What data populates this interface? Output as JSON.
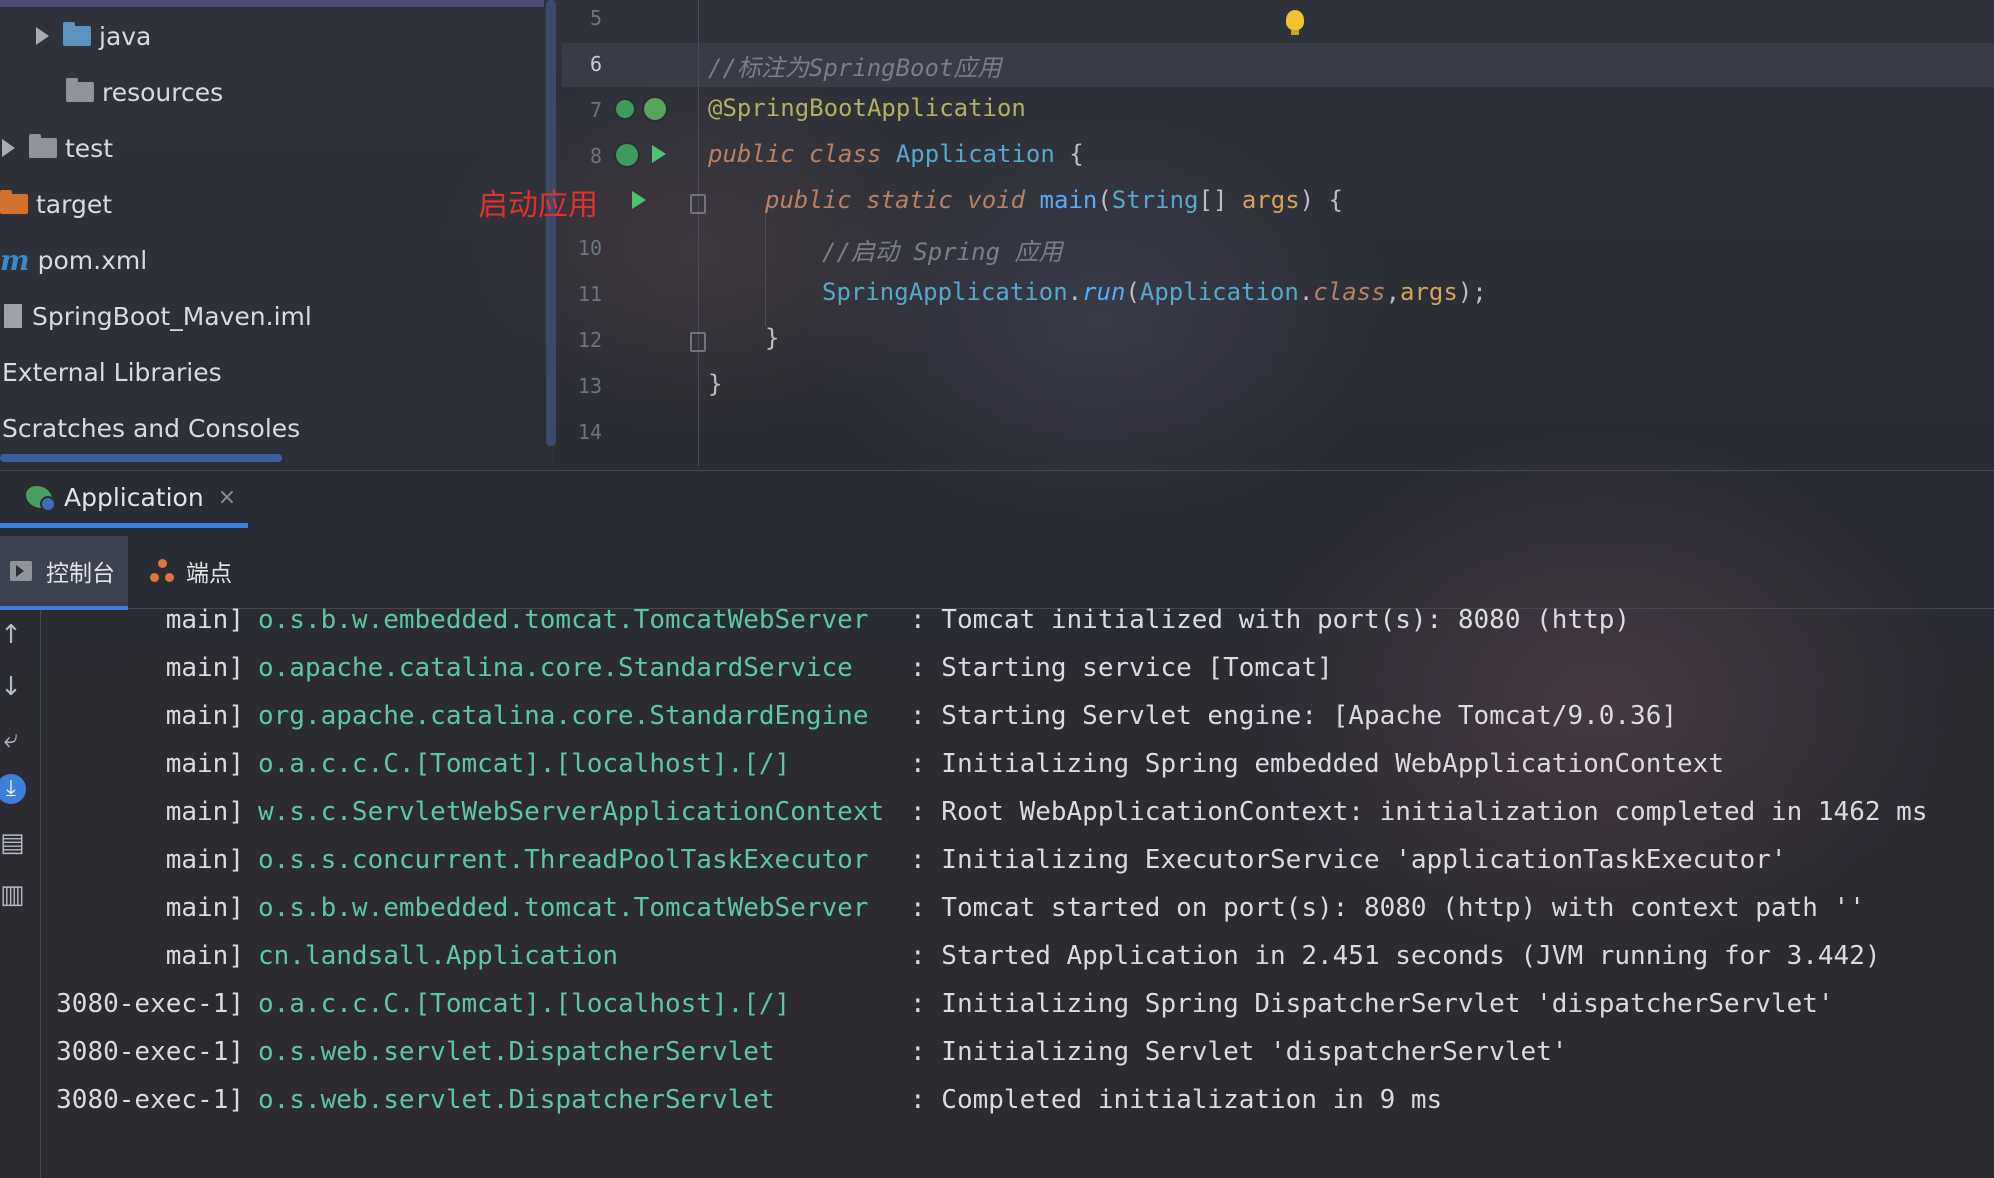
{
  "project_tree": {
    "items": [
      {
        "label": "java",
        "icon": "source-folder-icon"
      },
      {
        "label": "resources",
        "icon": "resources-folder-icon"
      },
      {
        "label": "test",
        "icon": "folder-icon"
      },
      {
        "label": "target",
        "icon": "excluded-folder-icon"
      },
      {
        "label": "pom.xml",
        "icon": "maven-icon"
      },
      {
        "label": "SpringBoot_Maven.iml",
        "icon": "module-file-icon"
      },
      {
        "label": "External Libraries"
      },
      {
        "label": "Scratches and Consoles"
      }
    ]
  },
  "editor": {
    "line_numbers": [
      "5",
      "6",
      "7",
      "8",
      "",
      "10",
      "11",
      "12",
      "13",
      "14"
    ],
    "annotation_label": "启动应用",
    "lines": {
      "l6": "//标注为SpringBoot应用",
      "l7": "@SpringBootApplication",
      "l8_kw": "public class ",
      "l8_cls": "Application",
      "l8_rest": " {",
      "l9_kw": "public static void ",
      "l9_fn": "main",
      "l9_p1": "(",
      "l9_cls": "String",
      "l9_p2": "[] ",
      "l9_arg": "args",
      "l9_p3": ") {",
      "l10": "//启动 Spring 应用",
      "l11_cls": "SpringApplication",
      "l11_dot": ".",
      "l11_fn": "run",
      "l11_p1": "(",
      "l11_cls2": "Application",
      "l11_dot2": ".",
      "l11_kw": "class",
      "l11_comma": ",",
      "l11_arg": "args",
      "l11_p2": ");",
      "l12": "}",
      "l13": "}"
    }
  },
  "run_panel": {
    "tab_label": "Application",
    "tab_close": "×",
    "subtabs": {
      "console": "控制台",
      "endpoints": "端点"
    }
  },
  "console": {
    "lines": [
      {
        "thread": "main]",
        "logger": "o.s.b.w.embedded.tomcat.TomcatWebServer",
        "message": ": Tomcat initialized with port(s): 8080 (http)"
      },
      {
        "thread": "main]",
        "logger": "o.apache.catalina.core.StandardService",
        "message": ": Starting service [Tomcat]"
      },
      {
        "thread": "main]",
        "logger": "org.apache.catalina.core.StandardEngine",
        "message": ": Starting Servlet engine: [Apache Tomcat/9.0.36]"
      },
      {
        "thread": "main]",
        "logger": "o.a.c.c.C.[Tomcat].[localhost].[/]",
        "message": ": Initializing Spring embedded WebApplicationContext"
      },
      {
        "thread": "main]",
        "logger": "w.s.c.ServletWebServerApplicationContext",
        "message": ": Root WebApplicationContext: initialization completed in 1462 ms"
      },
      {
        "thread": "main]",
        "logger": "o.s.s.concurrent.ThreadPoolTaskExecutor",
        "message": ": Initializing ExecutorService 'applicationTaskExecutor'"
      },
      {
        "thread": "main]",
        "logger": "o.s.b.w.embedded.tomcat.TomcatWebServer",
        "message": ": Tomcat started on port(s): 8080 (http) with context path ''"
      },
      {
        "thread": "main]",
        "logger": "cn.landsall.Application",
        "message": ": Started Application in 2.451 seconds (JVM running for 3.442)"
      },
      {
        "thread": "3080-exec-1]",
        "logger": "o.a.c.c.C.[Tomcat].[localhost].[/]",
        "message": ": Initializing Spring DispatcherServlet 'dispatcherServlet'"
      },
      {
        "thread": "3080-exec-1]",
        "logger": "o.s.web.servlet.DispatcherServlet",
        "message": ": Initializing Servlet 'dispatcherServlet'"
      },
      {
        "thread": "3080-exec-1]",
        "logger": "o.s.web.servlet.DispatcherServlet",
        "message": ": Completed initialization in 9 ms"
      }
    ]
  },
  "colors": {
    "accent": "#3d7fd9",
    "logger_green": "#5cc8a0",
    "annotation_red": "#e0312b"
  }
}
